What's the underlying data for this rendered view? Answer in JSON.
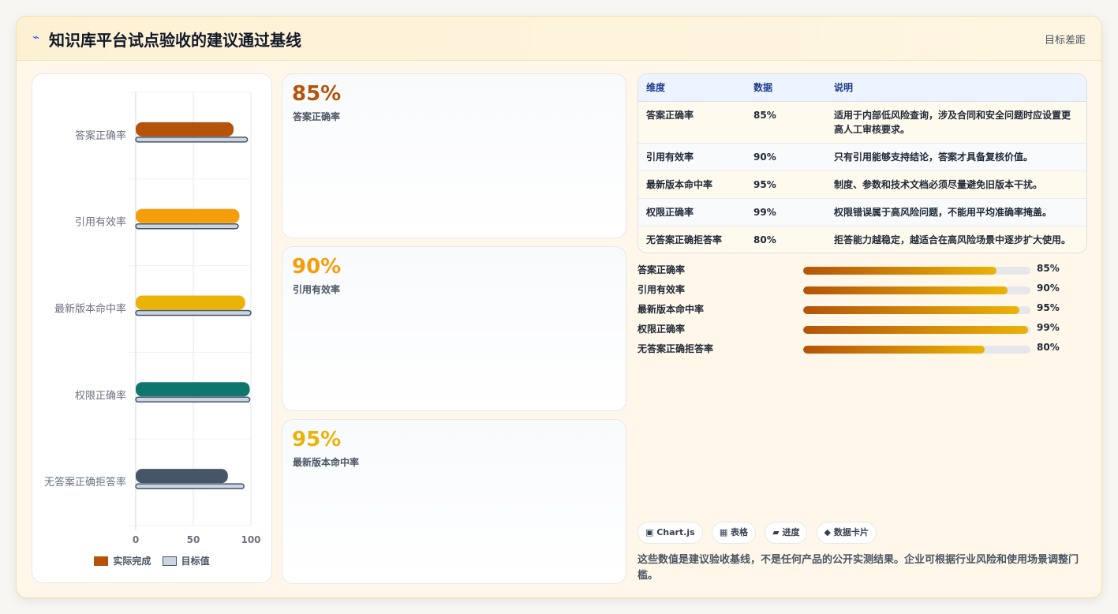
{
  "header": {
    "icon": "bolt-icon",
    "title": "知识库平台试点验收的建议通过基线",
    "right_label": "目标差距"
  },
  "chart_data": {
    "type": "bar",
    "orientation": "horizontal",
    "categories": [
      "答案正确率",
      "引用有效率",
      "最新版本命中率",
      "权限正确率",
      "无答案正确拒答率"
    ],
    "series": [
      {
        "name": "实际完成",
        "values": [
          85,
          90,
          95,
          99,
          80
        ],
        "colors": [
          "#b45309",
          "#f59e0b",
          "#eab308",
          "#0f766e",
          "#475569"
        ]
      },
      {
        "name": "目标值",
        "values": [
          97,
          89,
          100,
          99,
          94
        ],
        "color": "#cbd5e1"
      }
    ],
    "xlim": [
      0,
      100
    ],
    "xticks": [
      "0",
      "50",
      "100"
    ],
    "grid": true,
    "legend": "bottom"
  },
  "cards": [
    {
      "value": "85%",
      "label": "答案正确率",
      "color": "#b45309"
    },
    {
      "value": "90%",
      "label": "引用有效率",
      "color": "#f59e0b"
    },
    {
      "value": "95%",
      "label": "最新版本命中率",
      "color": "#eab308"
    }
  ],
  "table": {
    "headers": [
      "维度",
      "数据",
      "说明"
    ],
    "rows": [
      [
        "答案正确率",
        "85%",
        "适用于内部低风险查询，涉及合同和安全问题时应设置更高人工审核要求。"
      ],
      [
        "引用有效率",
        "90%",
        "只有引用能够支持结论，答案才具备复核价值。"
      ],
      [
        "最新版本命中率",
        "95%",
        "制度、参数和技术文档必须尽量避免旧版本干扰。"
      ],
      [
        "权限正确率",
        "99%",
        "权限错误属于高风险问题，不能用平均准确率掩盖。"
      ],
      [
        "无答案正确拒答率",
        "80%",
        "拒答能力越稳定，越适合在高风险场景中逐步扩大使用。"
      ]
    ]
  },
  "progress": [
    {
      "label": "答案正确率",
      "value": "85%",
      "fraction": 0.85
    },
    {
      "label": "引用有效率",
      "value": "90%",
      "fraction": 0.9
    },
    {
      "label": "最新版本命中率",
      "value": "95%",
      "fraction": 0.95
    },
    {
      "label": "权限正确率",
      "value": "99%",
      "fraction": 0.99
    },
    {
      "label": "无答案正确拒答率",
      "value": "80%",
      "fraction": 0.8
    }
  ],
  "tags": [
    "▣ Chart.js",
    "▦ 表格",
    "▰ 进度",
    "◆ 数据卡片"
  ],
  "note": "这些数值是建议验收基线，不是任何产品的公开实测结果。企业可根据行业风险和使用场景调整门槛。"
}
